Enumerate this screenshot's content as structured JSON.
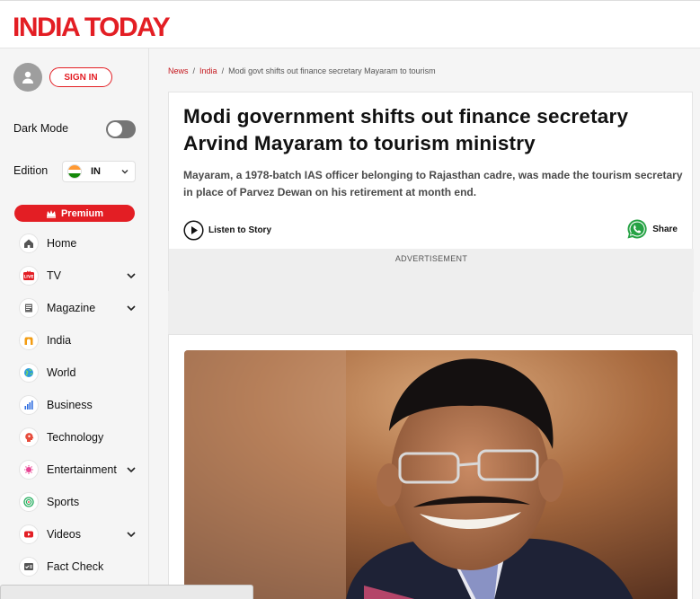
{
  "brand": {
    "logo_text": "INDIA TODAY",
    "accent_color": "#e31e24"
  },
  "sidebar": {
    "sign_in_label": "SIGN IN",
    "dark_mode_label": "Dark Mode",
    "dark_mode_on": false,
    "edition_label": "Edition",
    "edition_value": "IN",
    "premium_label": "Premium",
    "nav": [
      {
        "label": "Home",
        "icon": "home-icon",
        "has_dropdown": false
      },
      {
        "label": "TV",
        "icon": "live-tv-icon",
        "has_dropdown": true
      },
      {
        "label": "Magazine",
        "icon": "magazine-icon",
        "has_dropdown": true
      },
      {
        "label": "India",
        "icon": "india-gate-icon",
        "has_dropdown": false
      },
      {
        "label": "World",
        "icon": "globe-icon",
        "has_dropdown": false
      },
      {
        "label": "Business",
        "icon": "bar-chart-icon",
        "has_dropdown": false
      },
      {
        "label": "Technology",
        "icon": "tech-head-icon",
        "has_dropdown": false
      },
      {
        "label": "Entertainment",
        "icon": "entertainment-icon",
        "has_dropdown": true
      },
      {
        "label": "Sports",
        "icon": "sports-target-icon",
        "has_dropdown": false
      },
      {
        "label": "Videos",
        "icon": "video-play-icon",
        "has_dropdown": true
      },
      {
        "label": "Fact Check",
        "icon": "fact-check-icon",
        "has_dropdown": false
      }
    ]
  },
  "breadcrumb": {
    "items": [
      "News",
      "India"
    ],
    "current": "Modi govt shifts out finance secretary Mayaram to tourism"
  },
  "article": {
    "headline": "Modi government shifts out finance secretary Arvind Mayaram to tourism ministry",
    "summary": "Mayaram, a 1978-batch IAS officer belonging to Rajasthan cadre, was made the tourism secretary in place of Parvez Dewan on his retirement at month end.",
    "listen_label": "Listen to Story",
    "share_label": "Share",
    "ad_label": "ADVERTISEMENT"
  }
}
